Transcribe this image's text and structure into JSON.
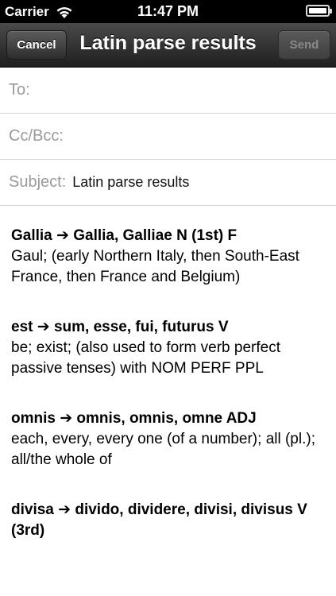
{
  "status_bar": {
    "carrier": "Carrier",
    "time": "11:47 PM"
  },
  "nav": {
    "title": "Latin parse results",
    "cancel_label": "Cancel",
    "send_label": "Send"
  },
  "fields": {
    "to_label": "To:",
    "cc_label": "Cc/Bcc:",
    "subject_label": "Subject:",
    "subject_value": "Latin parse results"
  },
  "entries": [
    {
      "head": "Gallia ➔ Gallia, Galliae N (1st) F",
      "def": "Gaul; (early Northern Italy, then South-East France, then France and Belgium)"
    },
    {
      "head": "est ➔ sum, esse, fui, futurus V",
      "def": "be; exist; (also used to form verb perfect passive tenses) with NOM PERF PPL"
    },
    {
      "head": "omnis ➔ omnis, omnis, omne ADJ",
      "def": "each, every, every one (of a number); all (pl.); all/the whole of"
    },
    {
      "head": "divisa ➔ divido, dividere, divisi, divisus V (3rd)",
      "def": ""
    }
  ]
}
